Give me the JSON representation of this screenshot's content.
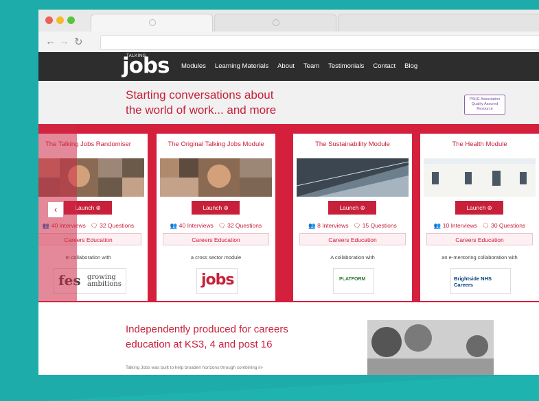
{
  "header": {
    "logo": "jobs",
    "logo_top": "TALKING",
    "menu": [
      "Modules",
      "Learning Materials",
      "About",
      "Team",
      "Testimonials",
      "Contact",
      "Blog"
    ]
  },
  "hero": {
    "line1": "Starting conversations about",
    "line2": "the world of work... and more",
    "badge": "PSHE Association Quality Assured Resource"
  },
  "modules": [
    {
      "title": "The Talking Jobs Randomiser",
      "launch": "Launch",
      "interviews": "40 Interviews",
      "questions": "32 Questions",
      "edu": "Careers Education",
      "collab": "In collaboration with",
      "partner": "growing ambitions"
    },
    {
      "title": "The Original Talking Jobs Module",
      "launch": "Launch",
      "interviews": "40 Interviews",
      "questions": "32 Questions",
      "edu": "Careers Education",
      "collab": "a cross sector module",
      "partner": "jobs"
    },
    {
      "title": "The Sustainability Module",
      "launch": "Launch",
      "interviews": "8 Interviews",
      "questions": "15 Questions",
      "edu": "Careers Education",
      "collab": "A collaboration with",
      "partner": "PLATFORM"
    },
    {
      "title": "The Health Module",
      "launch": "Launch",
      "interviews": "10 Interviews",
      "questions": "30 Questions",
      "edu": "Careers Education",
      "collab": "an e-mentoring collaboration with",
      "partner": "Brightside NHS Careers"
    }
  ],
  "lower": {
    "line1": "Independently produced for careers",
    "line2": "education at KS3, 4 and post 16",
    "text": "Talking Jobs was built to help broaden horizons through combining in-"
  },
  "colors": {
    "accent": "#c8203a",
    "teal": "#1fb3b0",
    "dark": "#2d2d2d"
  }
}
